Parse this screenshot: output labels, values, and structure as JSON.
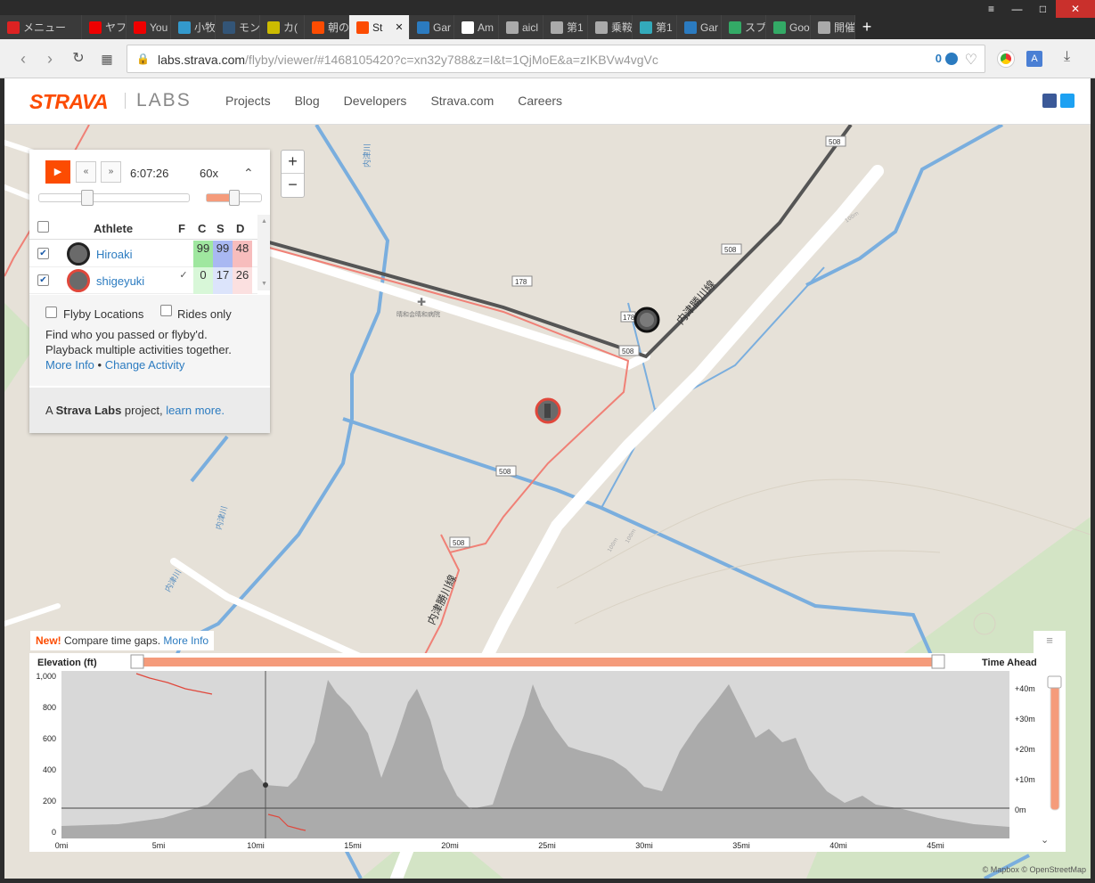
{
  "window_controls": {
    "menu": "≡",
    "minimize": "—",
    "maximize": "□",
    "close": "✕"
  },
  "tabs": [
    {
      "label": "メニュー",
      "color": "#d22"
    },
    {
      "label": "ヤフ",
      "color": "#e00"
    },
    {
      "label": "You",
      "color": "#e00"
    },
    {
      "label": "小牧",
      "color": "#39c"
    },
    {
      "label": "モン",
      "color": "#357"
    },
    {
      "label": "カ(",
      "color": "#cb0"
    },
    {
      "label": "朝の",
      "color": "#fc4c02"
    },
    {
      "label": "St",
      "color": "#fc4c02",
      "active": true
    },
    {
      "label": "Gar",
      "color": "#2b7bc0"
    },
    {
      "label": "Am",
      "color": "#fff"
    },
    {
      "label": "aicl",
      "color": "#aaa"
    },
    {
      "label": "第1",
      "color": "#aaa"
    },
    {
      "label": "乗鞍",
      "color": "#aaa"
    },
    {
      "label": "第1",
      "color": "#3ab"
    },
    {
      "label": "Gar",
      "color": "#2b7bc0"
    },
    {
      "label": "スプ",
      "color": "#3a6"
    },
    {
      "label": "Goo",
      "color": "#3a6"
    },
    {
      "label": "開催",
      "color": "#aaa"
    }
  ],
  "new_tab": "+",
  "tab_close": "✕",
  "address": {
    "host": "labs.strava.com",
    "path": "/flyby/viewer/#1468105420?c=xn32y788&z=I&t=1QjMoE&a=zIKBVw4vgVc",
    "badge": "0"
  },
  "header": {
    "logo": "STRAVA",
    "labs": "LABS",
    "nav": [
      "Projects",
      "Blog",
      "Developers",
      "Strava.com",
      "Careers"
    ]
  },
  "player": {
    "play": "▶",
    "rewind": "«",
    "forward": "»",
    "time": "6:07:26",
    "speed": "60x",
    "collapse": "⌃",
    "playback_position": 0.3,
    "speed_level": 0.5
  },
  "table": {
    "headers": [
      "Athlete",
      "F",
      "C",
      "S",
      "D"
    ],
    "rows": [
      {
        "name": "Hiroaki",
        "f": "",
        "c": "99",
        "s": "99",
        "d": "48",
        "checked": true,
        "ring": "#222"
      },
      {
        "name": "shigeyuki",
        "f": "✓",
        "c": "0",
        "s": "17",
        "d": "26",
        "checked": true,
        "ring": "#e0473b"
      }
    ],
    "stat_colors": {
      "c": "#9fe79f",
      "s": "#a9b8f2",
      "d": "#f7bdbd",
      "c_light": "#d8f7d8",
      "s_light": "#dce4fb",
      "d_light": "#fbe0e0"
    }
  },
  "options": {
    "flyby": "Flyby Locations",
    "rides": "Rides only",
    "desc1": "Find who you passed or flyby'd.",
    "desc2": "Playback multiple activities together.",
    "more_info": "More Info",
    "bullet": "•",
    "change": "Change Activity"
  },
  "footer": {
    "pre": "A",
    "brand": "Strava Labs",
    "mid": "project,",
    "link": "learn more."
  },
  "zoom": {
    "in": "+",
    "out": "−"
  },
  "map": {
    "labels": {
      "hospital": "晴和会晴和病院",
      "road_name_1": "内津勝川線",
      "road_name_2": "内津勝川線",
      "river_1": "内津川",
      "river_2": "内津川",
      "river_3": "内津川"
    },
    "road_numbers": [
      "508",
      "508",
      "508",
      "508",
      "508",
      "178",
      "178"
    ],
    "contours": [
      "100m",
      "100m",
      "100m"
    ]
  },
  "elevation": {
    "new": "New!",
    "compare": "Compare time gaps.",
    "more_info": "More Info",
    "title": "Elevation (ft)",
    "time_ahead": "Time Ahead",
    "y_ticks": [
      "1,000",
      "800",
      "600",
      "400",
      "200",
      "0"
    ],
    "x_ticks": [
      "0mi",
      "5mi",
      "10mi",
      "15mi",
      "20mi",
      "25mi",
      "30mi",
      "35mi",
      "40mi",
      "45mi"
    ],
    "right_ticks": [
      "+40m",
      "+30m",
      "+20m",
      "+10m",
      "0m"
    ],
    "menu": "≡",
    "scroll_down": "⌄"
  },
  "credit": "© Mapbox © OpenStreetMap"
}
